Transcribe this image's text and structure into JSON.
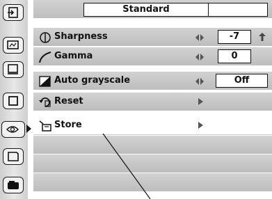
{
  "header": {
    "title": "Standard"
  },
  "sidebar": {
    "items": [
      {
        "icon": "input-icon"
      },
      {
        "icon": "screen-icon"
      },
      {
        "icon": "pc-adjust-icon"
      },
      {
        "icon": "picture-select-icon"
      },
      {
        "icon": "image-adjust-icon",
        "active": true
      },
      {
        "icon": "setting-icon"
      },
      {
        "icon": "projector-icon"
      }
    ]
  },
  "menu": {
    "rows": [
      {
        "label": "Sharpness",
        "icon": "sharpness-icon",
        "value": "-7"
      },
      {
        "label": "Gamma",
        "icon": "gamma-icon",
        "value": "0"
      },
      {
        "label": "Auto grayscale",
        "icon": "grayscale-icon",
        "value": "Off"
      },
      {
        "label": "Reset",
        "icon": "reset-icon"
      },
      {
        "label": "Store",
        "icon": "store-icon",
        "selected": true
      }
    ]
  }
}
